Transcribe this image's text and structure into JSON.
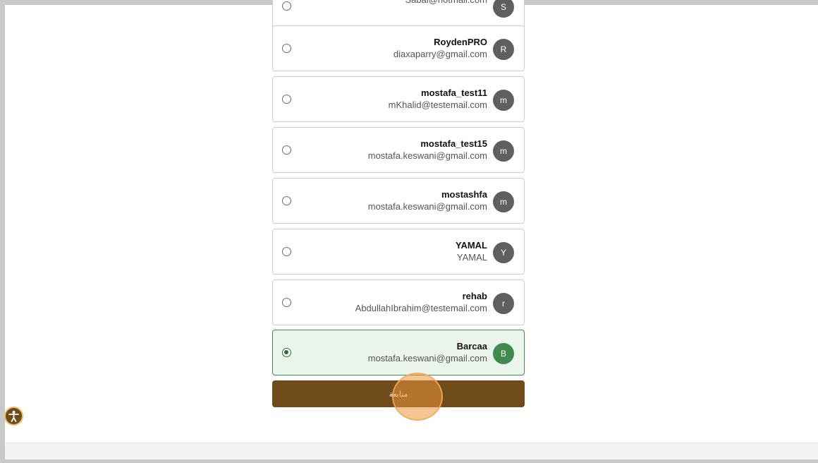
{
  "accounts": [
    {
      "name": "",
      "email": "Sabal@hotmail.com",
      "initial": "S",
      "selected": false
    },
    {
      "name": "RoydenPRO",
      "email": "diaxaparry@gmail.com",
      "initial": "R",
      "selected": false
    },
    {
      "name": "mostafa_test11",
      "email": "mKhalid@testemail.com",
      "initial": "m",
      "selected": false
    },
    {
      "name": "mostafa_test15",
      "email": "mostafa.keswani@gmail.com",
      "initial": "m",
      "selected": false
    },
    {
      "name": "mostashfa",
      "email": "mostafa.keswani@gmail.com",
      "initial": "m",
      "selected": false
    },
    {
      "name": "YAMAL",
      "email": "YAMAL",
      "initial": "Y",
      "selected": false
    },
    {
      "name": "rehab",
      "email": "AbdullahIbrahim@testemail.com",
      "initial": "r",
      "selected": false
    },
    {
      "name": "Barcaa",
      "email": "mostafa.keswani@gmail.com",
      "initial": "B",
      "selected": true
    }
  ],
  "continue_label": "متابعة",
  "colors": {
    "primary_button": "#6e4b19",
    "selected_border": "#3f8a4f",
    "selected_background": "#ecf5ec",
    "avatar_default": "#5f5f60",
    "avatar_selected": "#3f8a4f"
  }
}
